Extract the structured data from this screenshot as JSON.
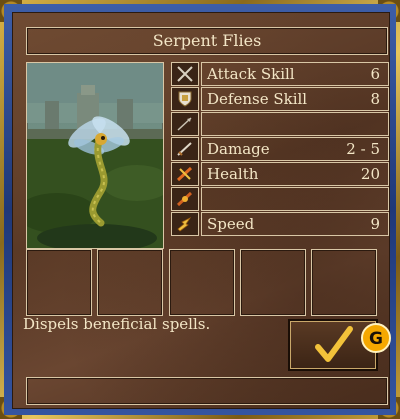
{
  "window": {
    "title": "Serpent Flies"
  },
  "stats": [
    {
      "icon": "crossed-swords-icon",
      "label": "Attack Skill",
      "value": "6"
    },
    {
      "icon": "shield-icon",
      "label": "Defense Skill",
      "value": "8"
    },
    {
      "icon": "arrow-icon",
      "label": "",
      "value": ""
    },
    {
      "icon": "sword-icon",
      "label": "Damage",
      "value": "2 - 5"
    },
    {
      "icon": "health-icon",
      "label": "Health",
      "value": "20"
    },
    {
      "icon": "spell-icon",
      "label": "",
      "value": ""
    },
    {
      "icon": "speed-icon",
      "label": "Speed",
      "value": "9"
    }
  ],
  "description": "Dispels beneficial spells.",
  "watermark": "G",
  "colors": {
    "text": "#f3e6c6",
    "checkmark": "#f2c23a",
    "badge": "#f5a800"
  }
}
